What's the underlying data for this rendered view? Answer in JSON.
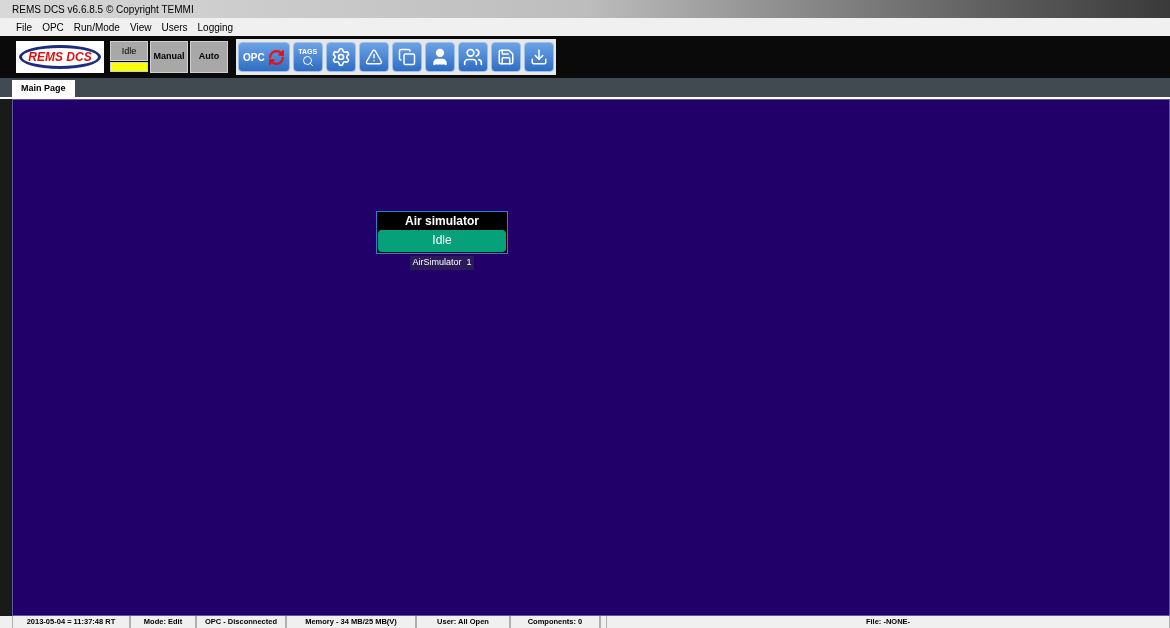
{
  "window": {
    "title": "REMS DCS v6.6.8.5 © Copyright TEMMI"
  },
  "menu": [
    "File",
    "OPC",
    "Run/Mode",
    "View",
    "Users",
    "Logging"
  ],
  "toolbar": {
    "logo": "REMS DCS",
    "modes": [
      {
        "label": "Idle",
        "selected": true
      },
      {
        "label": "Manual",
        "selected": false
      },
      {
        "label": "Auto",
        "selected": false
      }
    ],
    "opc_label": "OPC",
    "tags_label": "TAGS"
  },
  "tabs": [
    {
      "label": "Main Page",
      "selected": true
    }
  ],
  "canvas": {
    "components": [
      {
        "title": "Air simulator",
        "state": "Idle",
        "caption": "AirSimulator  1"
      }
    ]
  },
  "status_bar": [
    "2013-05-04 = 11:37:48 RT",
    "Mode: Edit",
    "OPC - Disconnected",
    "Memory - 34 MB/25 MB(V)",
    "User: All Open",
    "Components: 0",
    "File: -NONE-"
  ]
}
